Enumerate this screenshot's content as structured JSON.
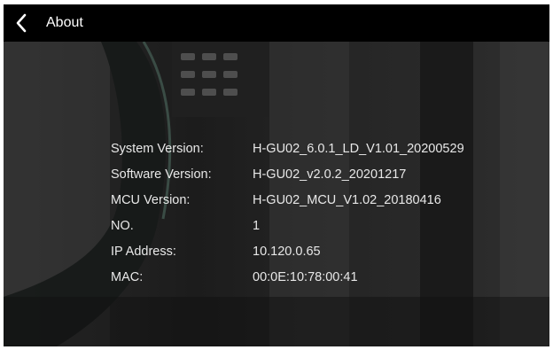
{
  "app": {
    "title": "About",
    "back_icon": "back-arrow-icon"
  },
  "colors": {
    "topbar": "#000000",
    "text": "#e8e8e8",
    "title": "#ffffff"
  },
  "info": [
    {
      "label": "System Version:",
      "value": "H-GU02_6.0.1_LD_V1.01_20200529"
    },
    {
      "label": "Software Version:",
      "value": "H-GU02_v2.0.2_20201217"
    },
    {
      "label": "MCU Version:",
      "value": "H-GU02_MCU_V1.02_20180416"
    },
    {
      "label": "NO.",
      "value": "1"
    },
    {
      "label": "IP Address:",
      "value": "10.120.0.65"
    },
    {
      "label": "MAC:",
      "value": "00:0E:10:78:00:41"
    }
  ]
}
